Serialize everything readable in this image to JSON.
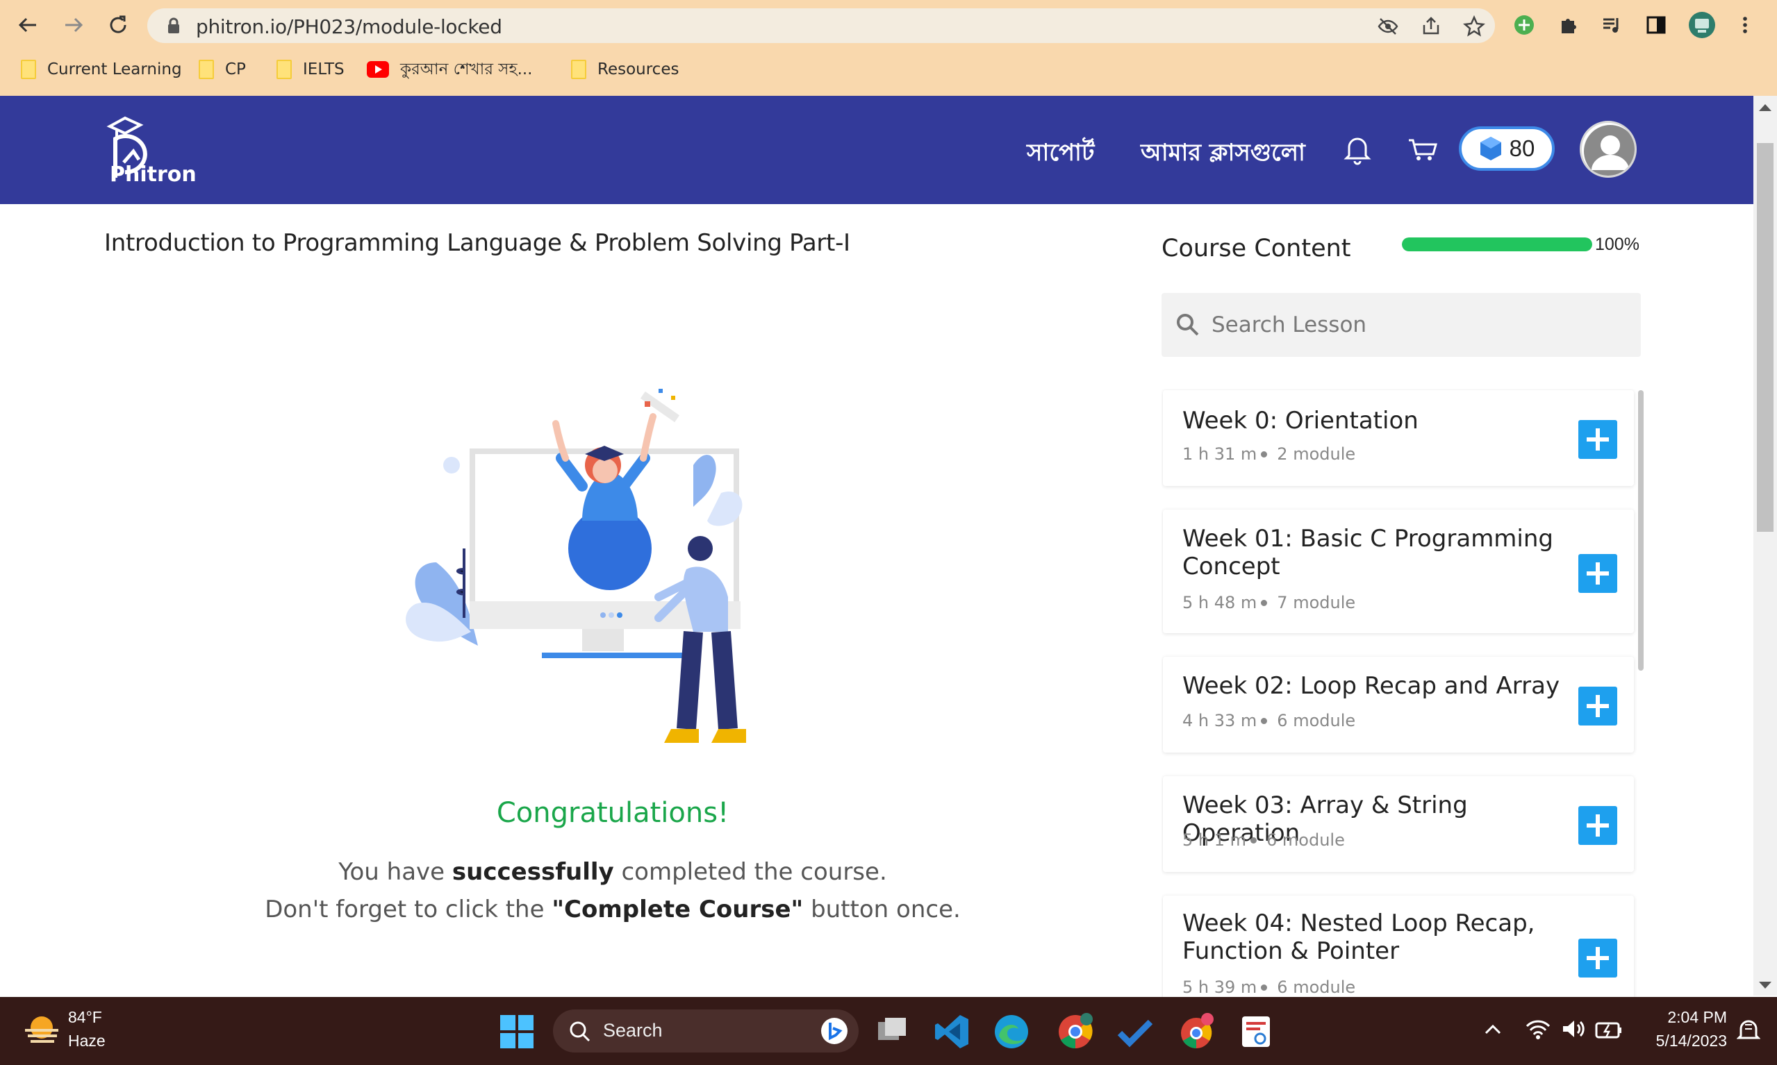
{
  "browser": {
    "url": "phitron.io/PH023/module-locked",
    "bookmarks": [
      "Current Learning",
      "CP",
      "IELTS",
      "কুরআন শেখার সহ...",
      "Resources"
    ]
  },
  "header": {
    "logo_text": "Phitron",
    "nav": [
      "সাপোর্ট",
      "আমার ক্লাসগুলো"
    ],
    "points": "80"
  },
  "main": {
    "course_title": "Introduction to Programming Language & Problem Solving Part-I",
    "congrats": "Congratulations!",
    "message_line1": {
      "pre": "You have ",
      "bold": "successfully",
      "post": " completed the course."
    },
    "message_line2": {
      "pre": "Don't forget to click the ",
      "bold": "\"Complete Course\"",
      "post": " button once."
    }
  },
  "sidebar": {
    "title": "Course Content",
    "progress_percent": 100,
    "progress_label": "100%",
    "search_placeholder": "Search Lesson",
    "weeks": [
      {
        "title": "Week 0: Orientation",
        "duration": "1 h 31 m",
        "modules": "2 module"
      },
      {
        "title": "Week 01: Basic C Programming Concept",
        "duration": "5 h 48 m",
        "modules": "7 module"
      },
      {
        "title": "Week 02: Loop Recap and Array",
        "duration": "4 h 33 m",
        "modules": "6 module"
      },
      {
        "title": "Week 03: Array & String Operation",
        "duration": "5 h 1 m",
        "modules": "6 module"
      },
      {
        "title": "Week 04: Nested Loop Recap, Function & Pointer",
        "duration": "5 h 39 m",
        "modules": "6 module"
      }
    ]
  },
  "taskbar": {
    "weather_temp": "84°F",
    "weather_condition": "Haze",
    "search_placeholder": "Search",
    "time": "2:04 PM",
    "date": "5/14/2023"
  },
  "colors": {
    "chrome_bg": "#f9d8ad",
    "header_bg": "#333a9a",
    "accent_green": "#1aa64a",
    "progress_green": "#22c55e",
    "plus_blue": "#1ea0ee",
    "taskbar_bg": "#351a17"
  }
}
